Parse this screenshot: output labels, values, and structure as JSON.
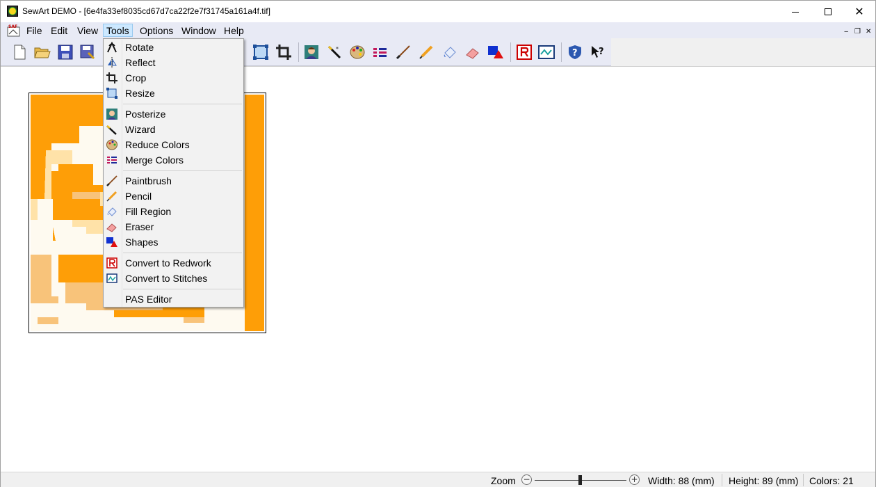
{
  "window": {
    "title": "SewArt DEMO - [6e4fa33ef8035cd67d7ca22f2e7f31745a161a4f.tif]",
    "min_glyph": "",
    "max_glyph": "",
    "close_glyph": "✕"
  },
  "menubar": {
    "logo_text": "SAF",
    "items": [
      {
        "label": "File"
      },
      {
        "label": "Edit"
      },
      {
        "label": "View"
      },
      {
        "label": "Tools",
        "active": true
      },
      {
        "label": "Options"
      },
      {
        "label": "Window"
      },
      {
        "label": "Help"
      }
    ],
    "mdi": {
      "minimize": "‒",
      "restore": "❐",
      "close": "✕"
    }
  },
  "toolbar": {
    "icons": [
      "new-file-icon",
      "open-folder-icon",
      "save-icon",
      "save-as-icon",
      "reflect-icon",
      "resize-icon",
      "crop-icon",
      "posterize-icon",
      "wizard-icon",
      "reduce-colors-icon",
      "merge-colors-icon",
      "paintbrush-icon",
      "pencil-icon",
      "fill-region-icon",
      "eraser-icon",
      "shapes-icon",
      "redwork-icon",
      "convert-stitches-icon",
      "help-icon",
      "context-help-icon"
    ]
  },
  "tools_menu": {
    "groups": [
      [
        {
          "label": "Rotate",
          "icon": "rotate-icon"
        },
        {
          "label": "Reflect",
          "icon": "reflect-icon"
        },
        {
          "label": "Crop",
          "icon": "crop-icon"
        },
        {
          "label": "Resize",
          "icon": "resize-icon"
        }
      ],
      [
        {
          "label": "Posterize",
          "icon": "posterize-icon"
        },
        {
          "label": "Wizard",
          "icon": "wizard-icon"
        },
        {
          "label": "Reduce Colors",
          "icon": "reduce-colors-icon"
        },
        {
          "label": "Merge Colors",
          "icon": "merge-colors-icon"
        }
      ],
      [
        {
          "label": "Paintbrush",
          "icon": "paintbrush-icon"
        },
        {
          "label": "Pencil",
          "icon": "pencil-icon"
        },
        {
          "label": "Fill Region",
          "icon": "fill-region-icon"
        },
        {
          "label": "Eraser",
          "icon": "eraser-icon"
        },
        {
          "label": "Shapes",
          "icon": "shapes-icon"
        }
      ],
      [
        {
          "label": "Convert to Redwork",
          "icon": "redwork-icon"
        },
        {
          "label": "Convert to Stitches",
          "icon": "convert-stitches-icon"
        }
      ],
      [
        {
          "label": "PAS Editor",
          "icon": ""
        }
      ]
    ]
  },
  "statusbar": {
    "zoom_label": "Zoom",
    "zoom_out": "−",
    "zoom_in": "+",
    "width": "Width: 88 (mm)",
    "height": "Height: 89 (mm)",
    "colors": "Colors: 21"
  },
  "colors": {
    "accent_menu_bg": "#e8eaf5",
    "menu_active_bg": "#cce8ff",
    "image_orange": "#fe9e07",
    "image_cream": "#fefaf0",
    "image_light": "#ffe2a8",
    "image_tan": "#f8c37a"
  }
}
